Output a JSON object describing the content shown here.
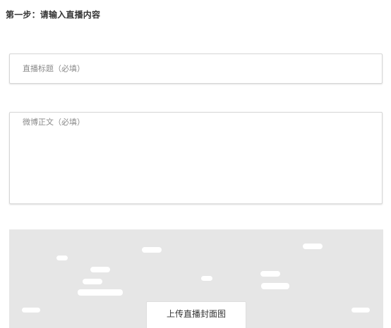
{
  "step_title": "第一步：请输入直播内容",
  "title_field": {
    "value": "",
    "placeholder": "直播标题（必填）"
  },
  "body_field": {
    "value": "",
    "placeholder": "微博正文（必填）"
  },
  "cover": {
    "upload_label": "上传直播封面图",
    "background_color": "#e6e6e6"
  }
}
